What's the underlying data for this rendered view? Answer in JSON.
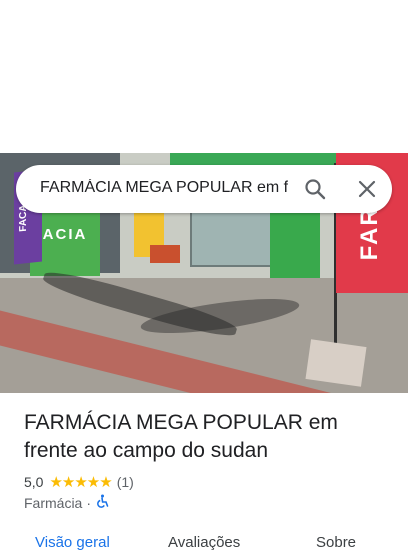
{
  "search": {
    "query": "FARMÁCIA MEGA POPULAR em frente ao campo do sudan",
    "search_icon": "search-icon",
    "close_icon": "close-icon"
  },
  "photo": {
    "store_sign": "ACIA",
    "left_banner": "FACA SEU",
    "right_banner": "FARMA"
  },
  "place": {
    "title": "FARMÁCIA MEGA POPULAR em frente ao campo do sudan",
    "rating": "5,0",
    "stars": "★★★★★",
    "review_count": "(1)",
    "category": "Farmácia",
    "separator": "·",
    "accessibility_icon": "wheelchair-icon"
  },
  "tabs": [
    {
      "label": "Visão geral"
    },
    {
      "label": "Avaliações"
    },
    {
      "label": "Sobre"
    }
  ],
  "colors": {
    "accent": "#1a73e8",
    "star": "#fbbc04"
  }
}
